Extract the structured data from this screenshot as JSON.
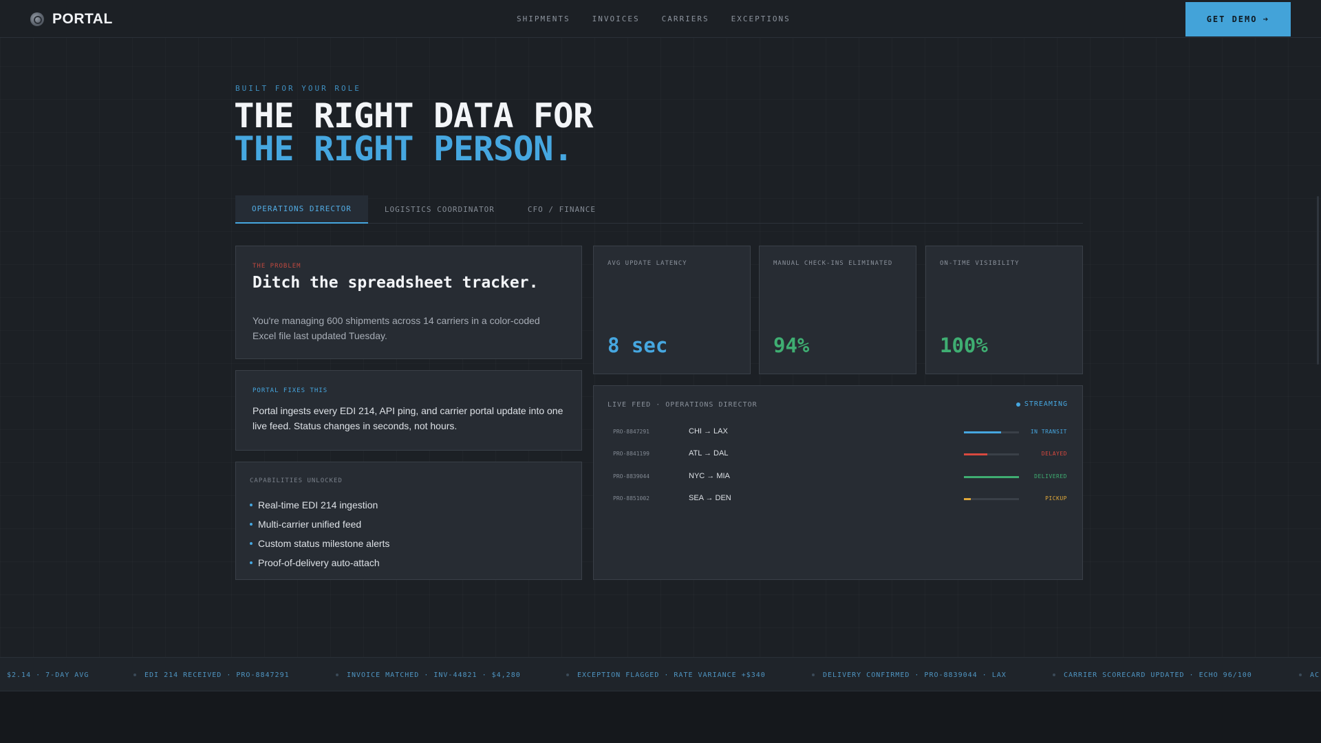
{
  "brand": {
    "name": "PORTAL"
  },
  "nav": {
    "links": [
      "SHIPMENTS",
      "INVOICES",
      "CARRIERS",
      "EXCEPTIONS"
    ],
    "cta": "GET DEMO",
    "cta_icon": "arrow-right-icon"
  },
  "hero": {
    "eyebrow": "BUILT FOR YOUR ROLE",
    "line1": "THE RIGHT DATA FOR",
    "line2": "THE RIGHT PERSON."
  },
  "tabs": [
    {
      "label": "OPERATIONS DIRECTOR",
      "active": true
    },
    {
      "label": "LOGISTICS COORDINATOR",
      "active": false
    },
    {
      "label": "CFO / FINANCE",
      "active": false
    }
  ],
  "problem": {
    "label": "THE PROBLEM",
    "title": "Ditch the spreadsheet tracker.",
    "body": "You're managing 600 shipments across 14 carriers in a color-coded Excel file last updated Tuesday."
  },
  "fixes": {
    "label": "PORTAL FIXES THIS",
    "body": "Portal ingests every EDI 214, API ping, and carrier portal update into one live feed. Status changes in seconds, not hours."
  },
  "capabilities": {
    "label": "CAPABILITIES UNLOCKED",
    "items": [
      "Real-time EDI 214 ingestion",
      "Multi-carrier unified feed",
      "Custom status milestone alerts",
      "Proof-of-delivery auto-attach"
    ]
  },
  "stats": [
    {
      "label": "AVG UPDATE LATENCY",
      "value": "8 sec",
      "color": "#46a7e0"
    },
    {
      "label": "MANUAL CHECK-INS ELIMINATED",
      "value": "94%",
      "color": "#3fae72"
    },
    {
      "label": "ON-TIME VISIBILITY",
      "value": "100%",
      "color": "#3fae72"
    }
  ],
  "feed": {
    "title": "LIVE FEED · OPERATIONS DIRECTOR",
    "streaming": "STREAMING",
    "rows": [
      {
        "pro": "PRO-8847291",
        "route": "CHI → LAX",
        "progress": 0.68,
        "status": "IN TRANSIT",
        "color": "#46a7e0"
      },
      {
        "pro": "PRO-8841199",
        "route": "ATL → DAL",
        "progress": 0.42,
        "status": "DELAYED",
        "color": "#d8493f"
      },
      {
        "pro": "PRO-8839044",
        "route": "NYC → MIA",
        "progress": 1.0,
        "status": "DELIVERED",
        "color": "#3fae72"
      },
      {
        "pro": "PRO-8851002",
        "route": "SEA → DEN",
        "progress": 0.12,
        "status": "PICKUP",
        "color": "#e0a83a"
      }
    ]
  },
  "ticker": [
    "$2.14 · 7-DAY AVG",
    "EDI 214 RECEIVED · PRO-8847291",
    "INVOICE MATCHED · INV-44821 · $4,280",
    "EXCEPTION FLAGGED · RATE VARIANCE +$340",
    "DELIVERY CONFIRMED · PRO-8839044 · LAX",
    "CARRIER SCORECARD UPDATED · ECHO 96/100",
    "AC"
  ]
}
